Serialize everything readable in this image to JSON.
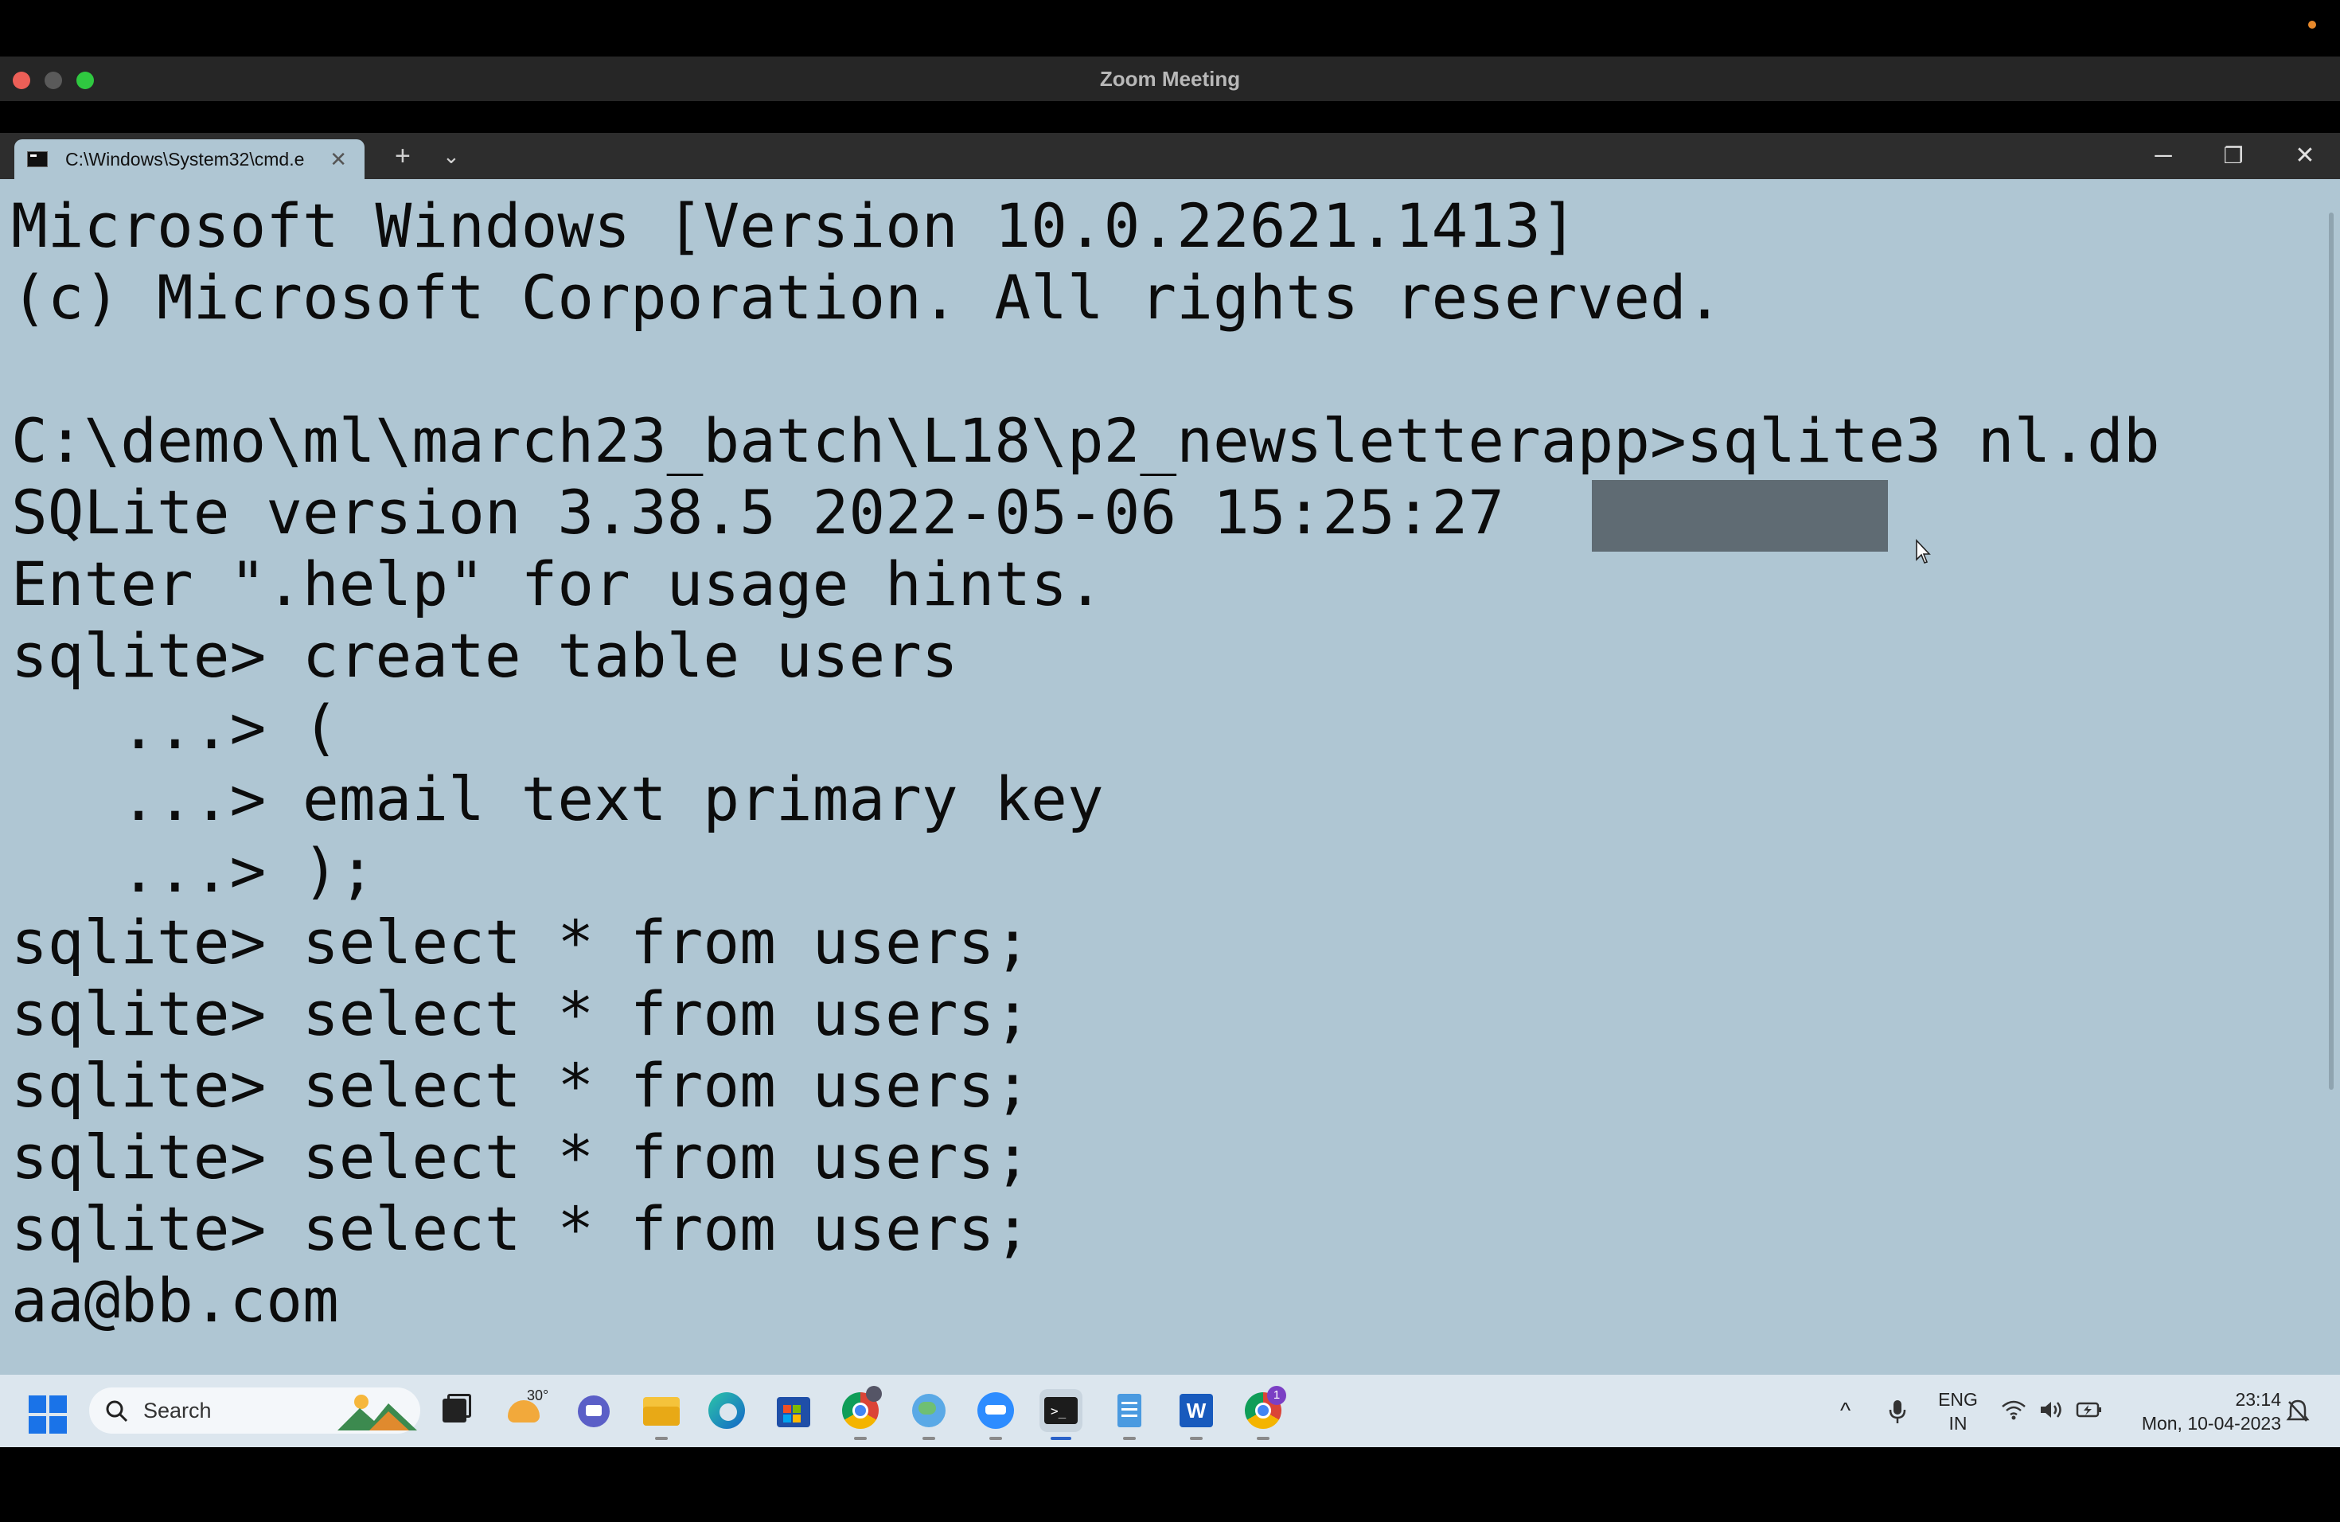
{
  "zoom": {
    "window_title": "Zoom Meeting"
  },
  "terminal": {
    "tab_title": "C:\\Windows\\System32\\cmd.e",
    "tab_close": "✕",
    "new_tab": "+",
    "dropdown": "⌄",
    "minimize": "─",
    "maximize": "❐",
    "close": "✕",
    "lines": [
      "Microsoft Windows [Version 10.0.22621.1413]",
      "(c) Microsoft Corporation. All rights reserved.",
      "",
      "C:\\demo\\ml\\march23_batch\\L18\\p2_newsletterapp>sqlite3 nl.db",
      "SQLite version 3.38.5 2022-05-06 15:25:27",
      "Enter \".help\" for usage hints.",
      "sqlite> create table users",
      "   ...> (",
      "   ...> email text primary key",
      "   ...> );",
      "sqlite> select * from users;",
      "sqlite> select * from users;",
      "sqlite> select * from users;",
      "sqlite> select * from users;",
      "sqlite> select * from users;",
      "aa@bb.com"
    ]
  },
  "taskbar": {
    "search_placeholder": "Search",
    "weather_temp": "30°",
    "chrome_badge": "1",
    "lang_top": "ENG",
    "lang_bottom": "IN",
    "time": "23:14",
    "date": "Mon, 10-04-2023",
    "tray_chevron": "^"
  },
  "colors": {
    "terminal_bg": "#afc6d3",
    "terminal_text": "#0c0c0c",
    "taskbar_bg": "#dce6ee",
    "accent": "#2a62c9"
  }
}
